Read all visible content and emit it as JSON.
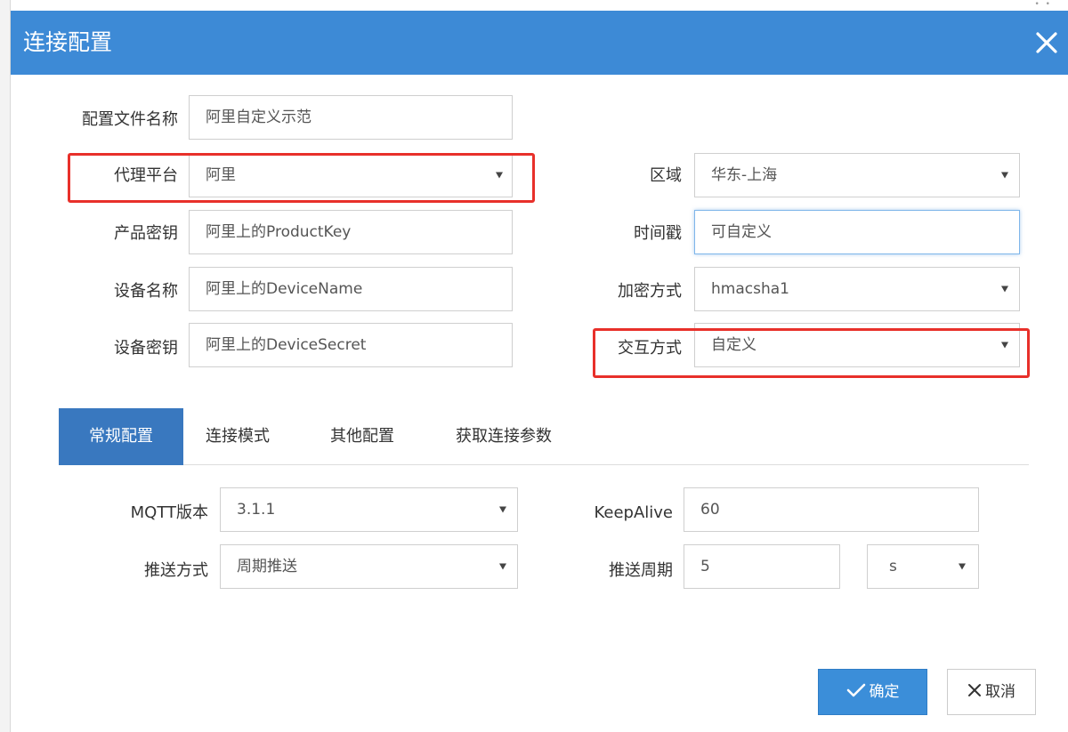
{
  "dialog": {
    "title": "连接配置"
  },
  "form": {
    "config_name": {
      "label": "配置文件名称",
      "value": "阿里自定义示范"
    },
    "proxy_platform": {
      "label": "代理平台",
      "value": "阿里"
    },
    "region": {
      "label": "区域",
      "value": "华东-上海"
    },
    "product_key": {
      "label": "产品密钥",
      "value": "阿里上的ProductKey"
    },
    "timestamp": {
      "label": "时间戳",
      "value": "可自定义"
    },
    "device_name": {
      "label": "设备名称",
      "value": "阿里上的DeviceName"
    },
    "encryption": {
      "label": "加密方式",
      "value": "hmacsha1"
    },
    "device_secret": {
      "label": "设备密钥",
      "value": "阿里上的DeviceSecret"
    },
    "interaction": {
      "label": "交互方式",
      "value": "自定义"
    }
  },
  "tabs": [
    {
      "label": "常规配置",
      "active": true
    },
    {
      "label": "连接模式",
      "active": false
    },
    {
      "label": "其他配置",
      "active": false
    },
    {
      "label": "获取连接参数",
      "active": false
    }
  ],
  "general": {
    "mqtt_version": {
      "label": "MQTT版本",
      "value": "3.1.1"
    },
    "keepalive": {
      "label": "KeepAlive",
      "value": "60"
    },
    "push_mode": {
      "label": "推送方式",
      "value": "周期推送"
    },
    "push_period": {
      "label": "推送周期",
      "value": "5",
      "unit": "s"
    }
  },
  "buttons": {
    "confirm": "确定",
    "cancel": "取消"
  },
  "colors": {
    "title_bar": "#3d8ad6",
    "active_tab": "#3978bf",
    "primary_button": "#3b8ed9",
    "highlight": "#e8302a"
  }
}
